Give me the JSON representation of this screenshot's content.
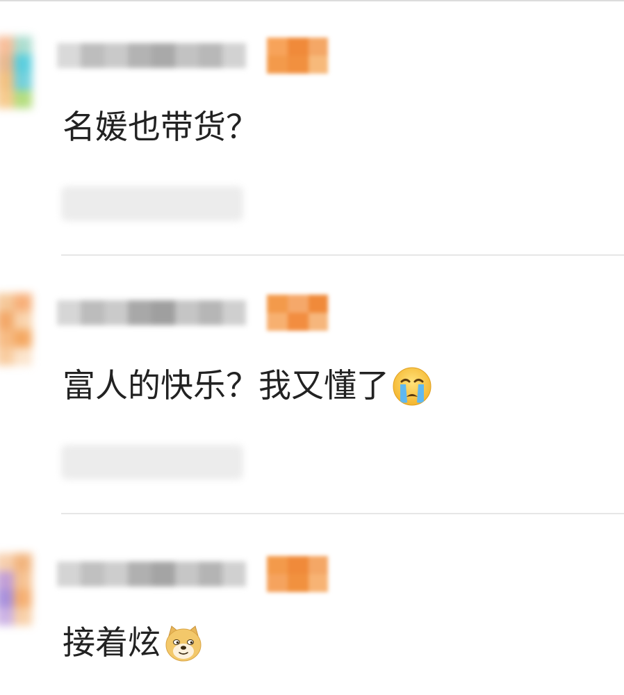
{
  "comments": [
    {
      "text": "名媛也带货？",
      "emoji": ""
    },
    {
      "text": "富人的快乐？我又懂了",
      "emoji": "crying-face-icon"
    },
    {
      "text": "接着炫",
      "emoji": "doge-face-icon"
    }
  ],
  "colors": {
    "text": "#222222",
    "badge": "#f08a3a",
    "divider": "#e6e6e6"
  }
}
